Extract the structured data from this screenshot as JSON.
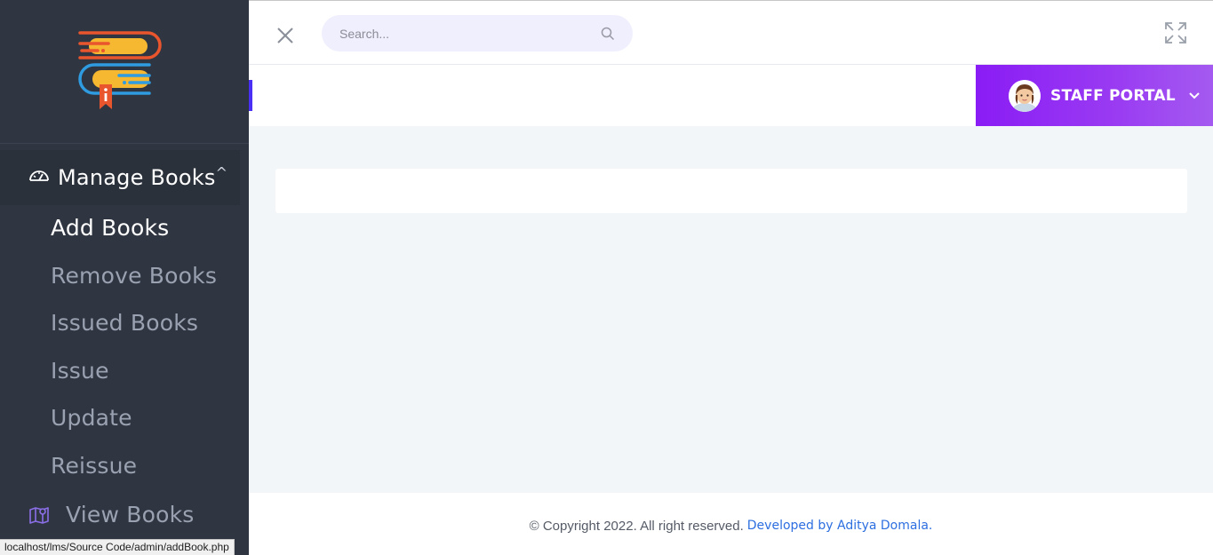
{
  "sidebar": {
    "group": {
      "label": "Manage Books",
      "icon": "gauge-icon",
      "caret": "^"
    },
    "items": [
      {
        "label": "Add Books",
        "active": true
      },
      {
        "label": "Remove Books"
      },
      {
        "label": "Issued Books"
      },
      {
        "label": "Issue"
      },
      {
        "label": "Update"
      },
      {
        "label": "Reissue"
      }
    ],
    "view_books": {
      "label": "View Books",
      "icon": "map-icon"
    }
  },
  "header": {
    "search": {
      "placeholder": "Search..."
    },
    "icons": [
      "close-icon",
      "search-icon",
      "fullscreen-icon"
    ]
  },
  "portal": {
    "label": "STAFF PORTAL",
    "avatar": "avatar-icon"
  },
  "footer": {
    "copyright": "© Copyright 2022. All right reserved.",
    "developer": "Developed by Aditya Domala."
  },
  "status_bar": {
    "url": "localhost/lms/Source Code/admin/addBook.php"
  },
  "colors": {
    "sidebar_bg": "#303641",
    "portal_gradient_start": "#8a1cf5",
    "portal_gradient_end": "#a45af0",
    "accent_blue": "#4a2ff5",
    "link": "#2d6fe0"
  }
}
